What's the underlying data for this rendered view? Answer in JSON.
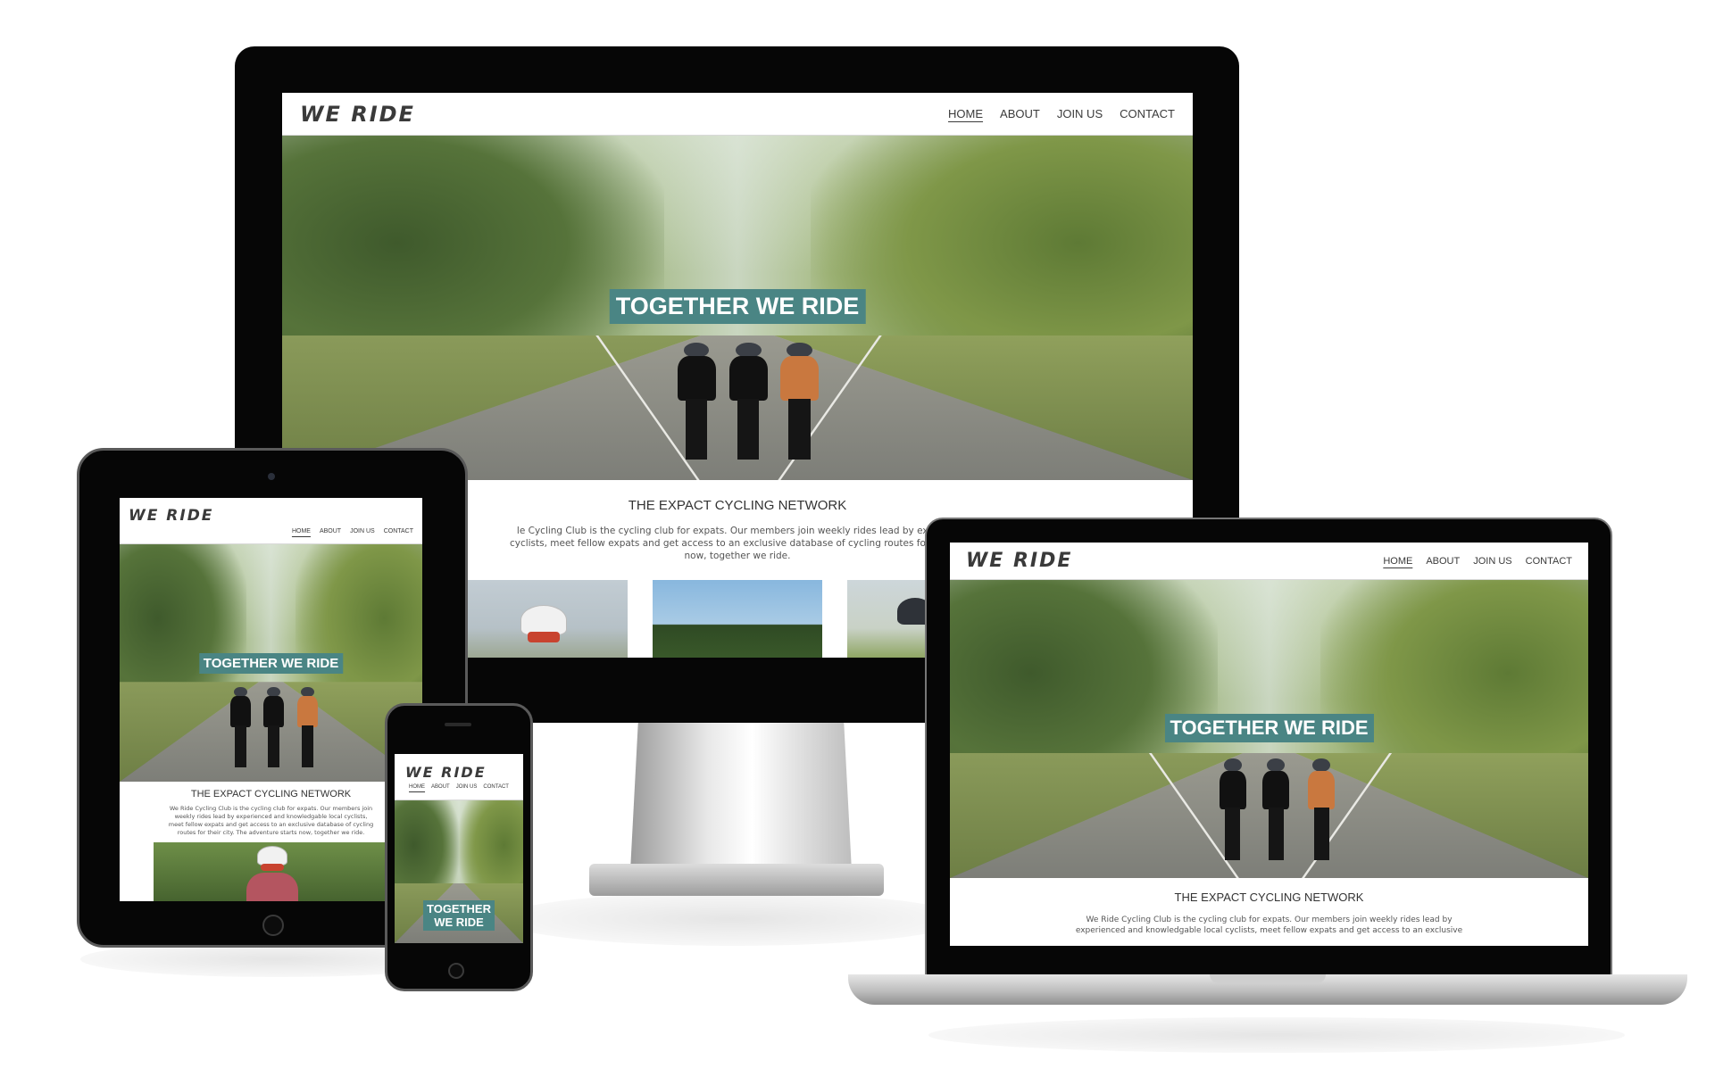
{
  "site": {
    "logo": "WE RIDE",
    "nav": [
      {
        "label": "HOME",
        "active": true
      },
      {
        "label": "ABOUT",
        "active": false
      },
      {
        "label": "JOIN US",
        "active": false
      },
      {
        "label": "CONTACT",
        "active": false
      }
    ],
    "hero_title": "TOGETHER WE RIDE",
    "hero_title_line1": "TOGETHER",
    "hero_title_line2": "WE RIDE",
    "network_title": "THE EXPACT CYCLING NETWORK",
    "monitor_text_line1": "le Cycling Club is the cycling club for expats. Our members join weekly rides lead by experien",
    "monitor_text_line2": "cyclists, meet fellow expats and get access to an exclusive database of cycling routes for their ci",
    "monitor_text_line3": "now, together we ride.",
    "tablet_text_line1": "We Ride Cycling Club is the cycling club for expats. Our members join",
    "tablet_text_line2": "weekly rides lead by experienced and knowledgable local cyclists,",
    "tablet_text_line3": "meet fellow expats and get access to an exclusive database of cycling",
    "tablet_text_line4": "routes for their city. The adventure starts now, together we ride.",
    "laptop_text_line1": "We Ride Cycling Club is the cycling club for expats. Our members join weekly rides lead by",
    "laptop_text_line2": "experienced and knowledgable local cyclists, meet fellow expats and get access to an exclusive"
  },
  "colors": {
    "banner": "#4a8584",
    "bezel": "#060606",
    "text": "#3a3a3a"
  }
}
